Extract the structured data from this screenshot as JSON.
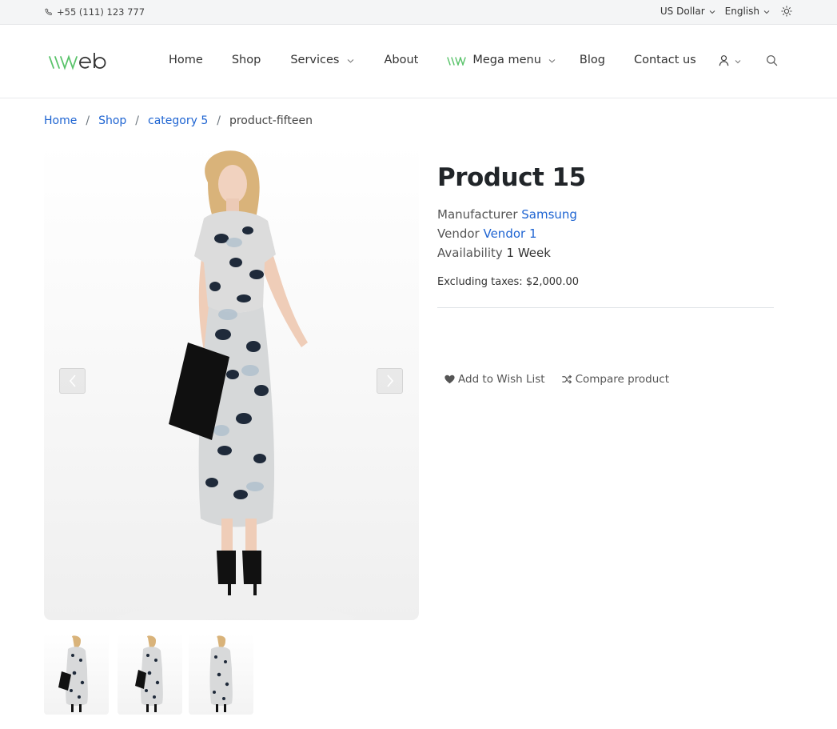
{
  "topbar": {
    "phone": "+55 (111) 123 777",
    "currency": "US Dollar",
    "language": "English"
  },
  "header": {
    "nav": {
      "home": "Home",
      "shop": "Shop",
      "services": "Services",
      "about": "About",
      "mega_menu": "Mega menu",
      "blog": "Blog",
      "contact": "Contact us"
    }
  },
  "breadcrumb": {
    "home": "Home",
    "shop": "Shop",
    "category": "category 5",
    "current": "product-fifteen"
  },
  "product": {
    "title": "Product 15",
    "manufacturer_label": "Manufacturer",
    "manufacturer": "Samsung",
    "vendor_label": "Vendor",
    "vendor": "Vendor 1",
    "availability_label": "Availability",
    "availability": "1 Week",
    "price_label": "Excluding taxes:",
    "price": "$2,000.00",
    "wishlist_label": "Add to Wish List",
    "compare_label": "Compare product"
  },
  "icons": {
    "phone": "phone-icon",
    "chevron": "chevron-down-icon",
    "theme": "sun-icon",
    "user": "user-icon",
    "search": "search-icon",
    "heart": "heart-icon",
    "shuffle": "shuffle-icon",
    "prev": "chevron-left-icon",
    "next": "chevron-right-icon"
  },
  "colors": {
    "link": "#1e64d2",
    "logo_green": "#59c36a",
    "text": "#212529"
  }
}
